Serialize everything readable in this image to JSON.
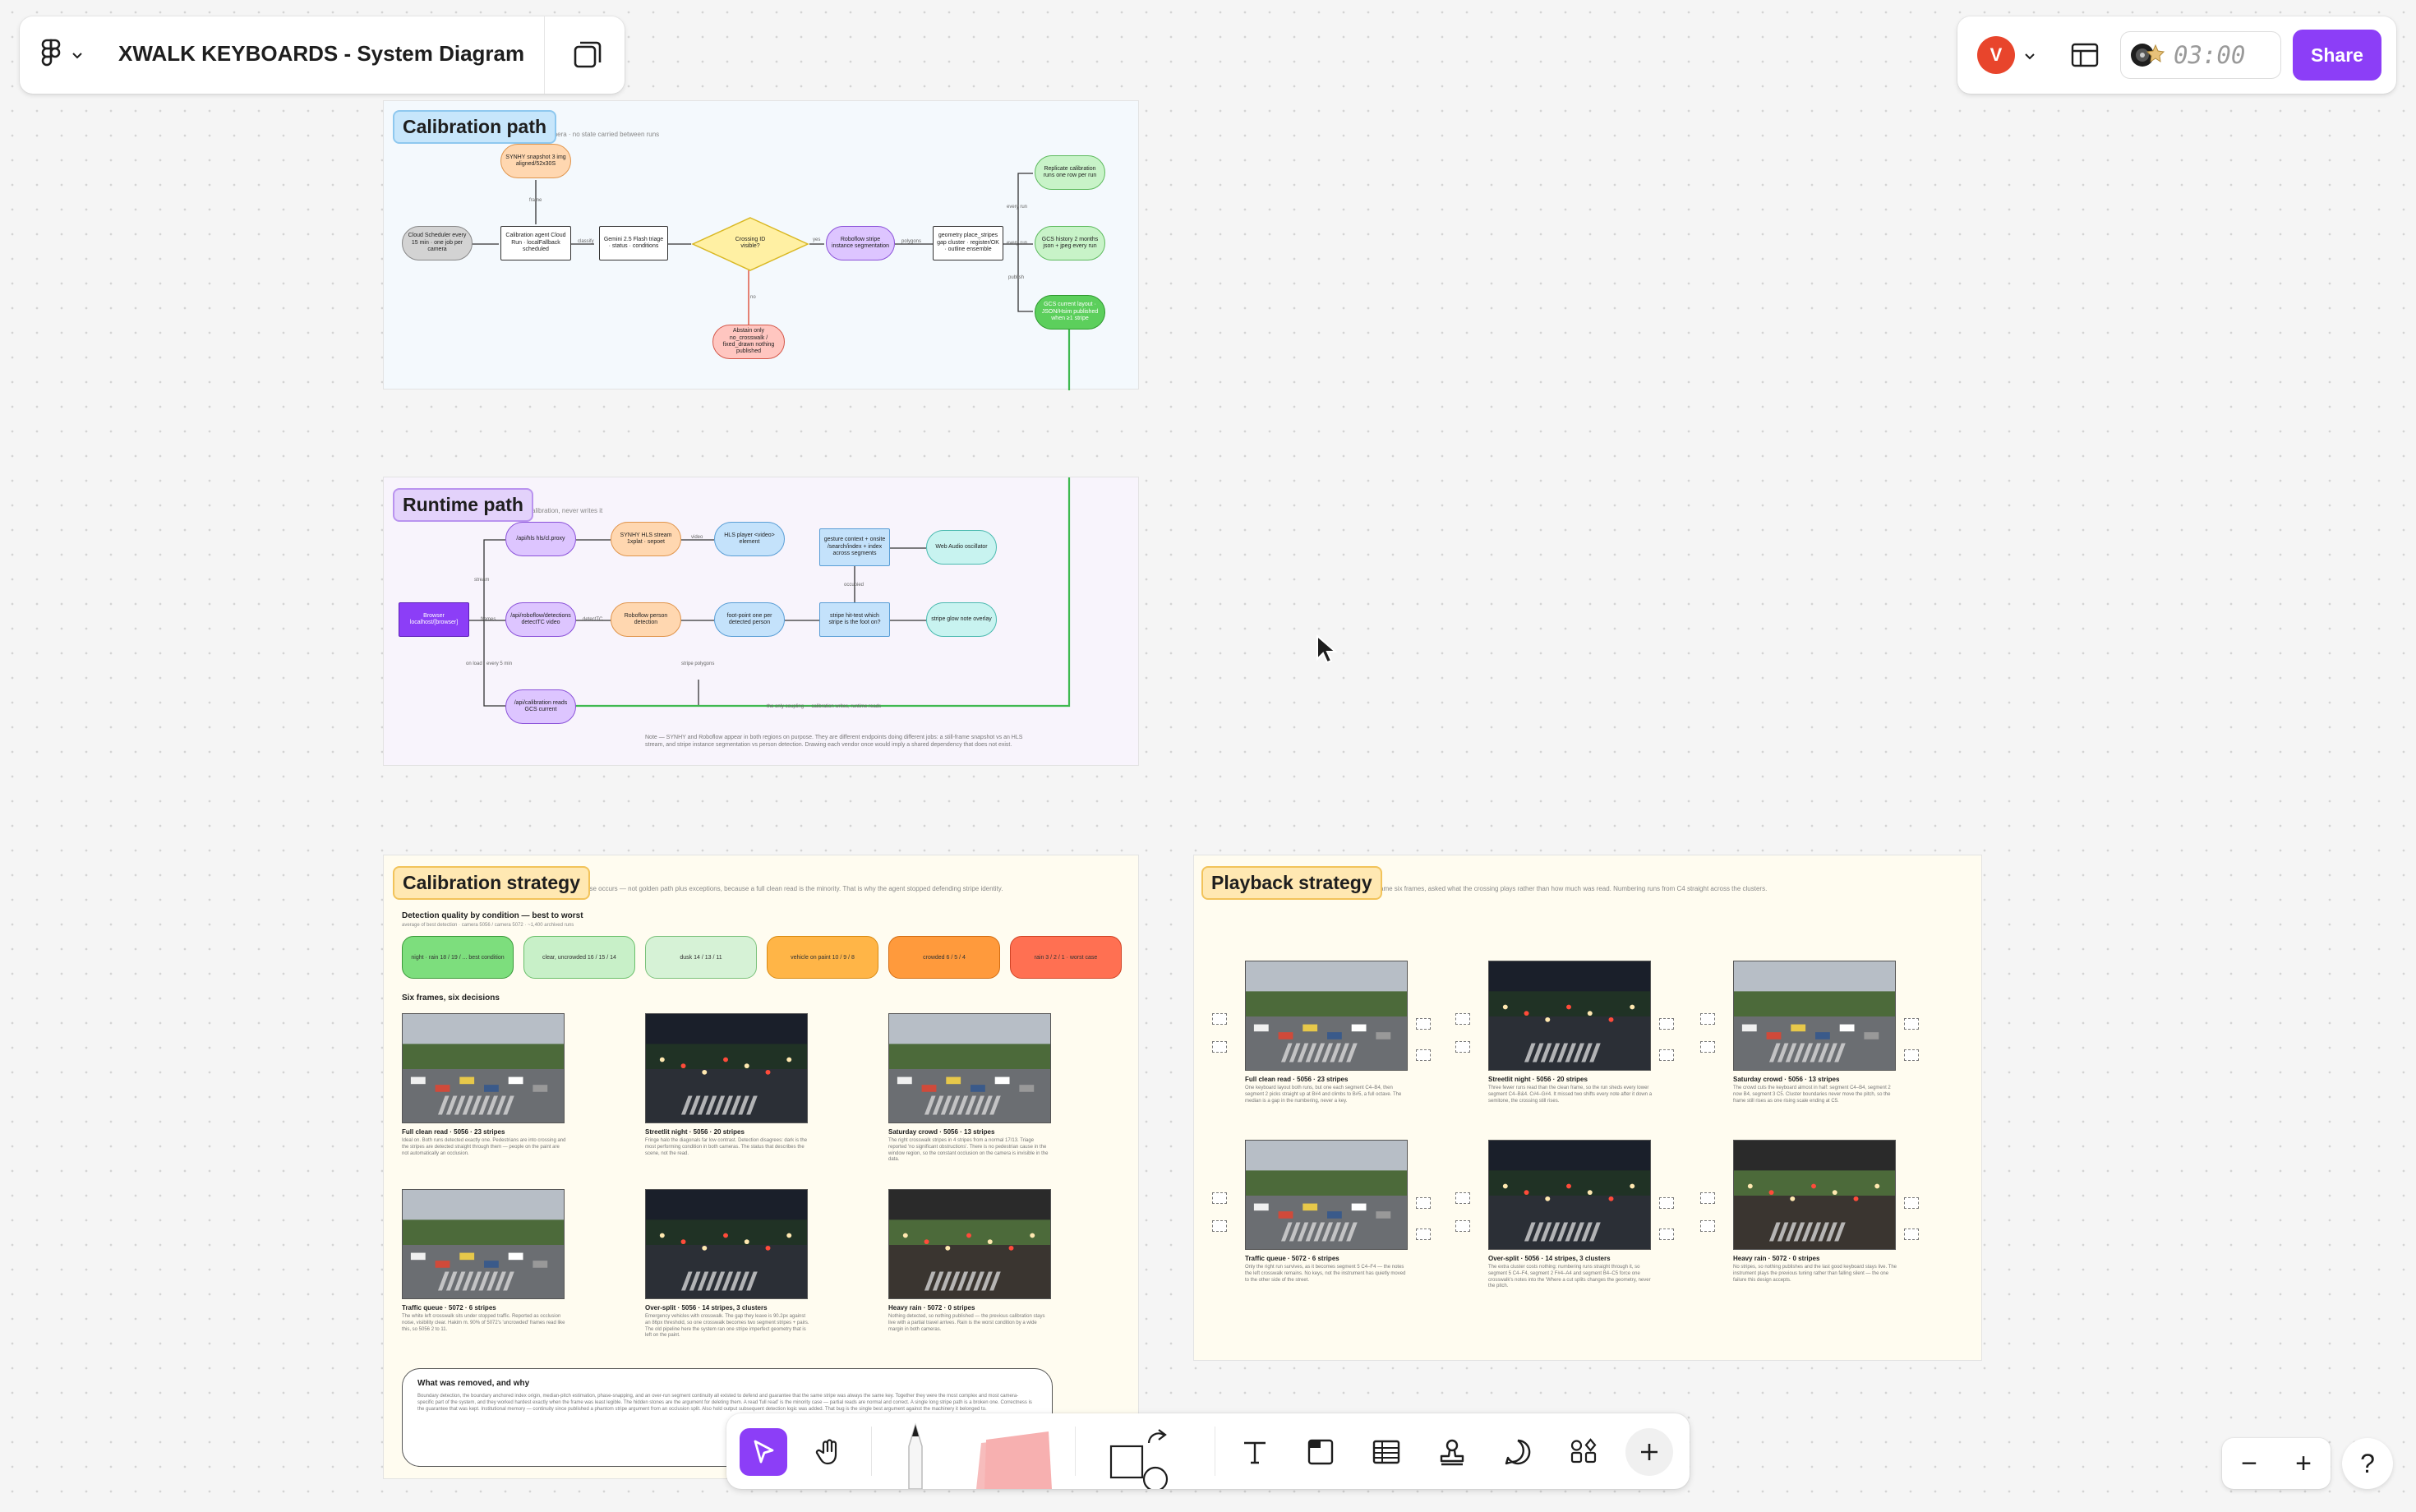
{
  "header": {
    "file_title": "XWALK KEYBOARDS - System Diagram"
  },
  "topright": {
    "avatar_initial": "V",
    "timer": "03:00",
    "share_label": "Share"
  },
  "calibration_path": {
    "label": "Calibration path",
    "subtitle": "camera · no state carried between runs",
    "nodes": {
      "snapshot": "SYNHY snapshot 3 img aligned/52x30S",
      "scheduler": "Cloud Scheduler every 15 min · one job per camera",
      "agent": "Calibration agent Cloud Run · localFallback scheduled",
      "gemini": "Gemini 2.5 Flash triage · status · conditions",
      "decision": "Crossing ID visible?",
      "roboflow": "Roboflow stripe instance segmentation",
      "geometry": "geometry place_stripes gap cluster · register/OK · outline ensemble",
      "registry": "Replicate calibration runs one row per run",
      "gcs": "GCS history 2 months json + jpeg every run",
      "current": "GCS current layout · JSON/Hsim published when ≥1 stripe",
      "abstain": "Abstain only no_crosswalk / fixed_drawn nothing published"
    },
    "edges": {
      "frame": "frame",
      "classify": "classify",
      "yes": "yes",
      "polygons": "polygons",
      "no": "no",
      "every_run": "every run",
      "every_run2": "every run",
      "publish": "publish"
    }
  },
  "runtime_path": {
    "label": "Runtime path",
    "subtitle": "calibration, never writes it",
    "nodes": {
      "browser": "Browser localhost/[browser]",
      "hls": "/api/hls hls/cl.proxy",
      "synhy": "SYNHY HLS stream 1xplat · sepoet",
      "hlsplayer": "HLS player <video> element",
      "gesture": "gesture context + onsite /search/index + index across segments",
      "webaudio": "Web Audio oscillator",
      "frames": "/api/roboflow/detections detectTC video",
      "roboflow": "Roboflow person detection",
      "footpoint": "foot-point one per detected person",
      "stripe": "stripe hit-test which stripe is the foot on?",
      "glow": "stripe glow note overlay",
      "apicalib": "/api/calibration reads GCS current"
    },
    "edges": {
      "stream": "stream",
      "video": "video",
      "frames": "frames",
      "detectTC": "detectTC",
      "occupied": "occupied",
      "on_load": "on load · every 5 min",
      "stripe_polygons": "stripe polygons",
      "link": "the only coupling — calibration writes, runtime reads"
    },
    "note": "Note — SYNHY and Roboflow appear in both regions on purpose. They are different endpoints doing different jobs: a still-frame snapshot vs an HLS stream, and stripe instance segmentation vs person detection. Drawing each vendor once would imply a shared dependency that does not exist."
  },
  "calibration_strategy": {
    "label": "Calibration strategy",
    "subtitle": "case occurs — not golden path plus exceptions, because a full clean read is the minority. That is why the agent stopped defending stripe identity.",
    "quality_title": "Detection quality by condition — best to worst",
    "quality_sub": "average of best detection · camera 5056 / camera 5072 · ~1,400 archived runs",
    "pills": [
      {
        "text": "night · rain 18 / 19 / ... best condition",
        "bg": "#7dde7d",
        "border": "#3a9a3a"
      },
      {
        "text": "clear, uncrowded 16 / 15 / 14",
        "bg": "#c8f0c8",
        "border": "#6abf6a"
      },
      {
        "text": "dusk 14 / 13 / 11",
        "bg": "#d6f2d6",
        "border": "#7cc27c"
      },
      {
        "text": "vehicle on paint 10 / 9 / 8",
        "bg": "#ffb547",
        "border": "#d98a12"
      },
      {
        "text": "crowded 6 / 5 / 4",
        "bg": "#ff9a3c",
        "border": "#d36d12"
      },
      {
        "text": "rain 3 / 2 / 1 · worst case",
        "bg": "#ff7052",
        "border": "#d04426"
      }
    ],
    "frames_title": "Six frames, six decisions",
    "frames": [
      {
        "title": "Full clean read · 5056 · 23 stripes",
        "desc": "Ideal on. Both runs detected exactly one. Pedestrians are into crossing and the stripes are detected straight through them — people on the paint are not automatically an occlusion."
      },
      {
        "title": "Streetlit night · 5056 · 20 stripes",
        "desc": "Fringe halo the diagonals far low contrast. Detection disagrees: dark is the most performing condition in both cameras. The status that describes the scene, not the read."
      },
      {
        "title": "Saturday crowd · 5056 · 13 stripes",
        "desc": "The right crosswalk stripes in 4 stripes from a normal 17/13. Triage reported 'no significant obstructions'. There is no pedestrian cause in the window region, so the constant occlusion on the camera is invisible in the data."
      },
      {
        "title": "Traffic queue · 5072 · 6 stripes",
        "desc": "The white left crosswalk sits under stopped traffic. Reported as occlusion noise, visibility clear. Hakim m. 90% of 5072's 'uncrowded' frames read like this, so 5056 2 to 11."
      },
      {
        "title": "Over-split · 5056 · 14 stripes, 3 clusters",
        "desc": "Emergency vehicles with crosswalk. The gap they leave is 90.2px against an 86px threshold, so one crosswalk becomes two segment stripes + pairs. The old pipeline here the system ran one stripe imperfect geometry that is left on the paint."
      },
      {
        "title": "Heavy rain · 5072 · 0 stripes",
        "desc": "Nothing detected, so nothing published — the previous calibration stays live with a partial travel arrives. Rain is the worst condition by a wide margin in both cameras."
      }
    ],
    "removed_title": "What was removed, and why",
    "removed_text": "Boundary detection, the boundary anchored index origin, median-pitch estimation, phase-snapping, and an over-run segment continuity all existed to defend and guarantee that the same stripe was always the same key. Together they were the most complex and most camera-specific part of the system, and they worked hardest exactly when the frame was least legible. The hidden stones are the argument for deleting them. A read 'full read' is the minority case — partial reads are normal and correct. A single long stripe path is a broken one. Correctness is the guarantee that was kept. Institutional memory — continuity since published a phantom stripe argument from an occlusion split. Also hold output subsequent detection logic was added. That bug is the single best argument against the machinery it belonged to."
  },
  "playback_strategy": {
    "label": "Playback strategy",
    "subtitle": "same six frames, asked what the crossing plays rather than how much was read. Numbering runs from C4 straight across the clusters.",
    "frames": [
      {
        "title": "Full clean read · 5056 · 23 stripes",
        "desc": "One keyboard layout both runs, but one each segment C4–B4, then segment 2 picks straight up at B#4 and climbs to B#5, a full octave. The median is a gap in the numbering, never a key."
      },
      {
        "title": "Streetlit night · 5056 · 20 stripes",
        "desc": "Three fewer runs read than the clean frame, so the run sheds every lower segment C4–B&4. C#4–G#4. It missed two shifts every note after it down a semitone, the crossing still rises."
      },
      {
        "title": "Saturday crowd · 5056 · 13 stripes",
        "desc": "The crowd cuts the keyboard almost in half: segment C4–B4, segment 2 now B4, segment 3 C5. Cluster boundaries never move the pitch, so the frame still rises as one rising scale ending at C5."
      },
      {
        "title": "Traffic queue · 5072 · 6 stripes",
        "desc": "Only the right run survives, as it becomes segment 5 C4–F4 — the notes the left crosswalk remains. No keys, not the instrument has quietly moved to the other side of the street."
      },
      {
        "title": "Over-split · 5056 · 14 stripes, 3 clusters",
        "desc": "The extra cluster costs nothing: numbering runs straight through it, so segment 5 C4–F4, segment 2 F#4–A4 and segment B4–C5 force one crosswalk's notes into the 'Where a cut splits changes the geometry, never the pitch."
      },
      {
        "title": "Heavy rain · 5072 · 0 stripes",
        "desc": "No stripes, so nothing publishes and the last good keyboard stays live. The instrument plays the previous tuning rather than falling silent — the one failure this design accepts."
      }
    ]
  },
  "toolbar": {
    "tools": [
      "Move",
      "Hand",
      "Pencil",
      "Sticky note",
      "Shape",
      "Connector",
      "Text",
      "Section",
      "Table",
      "Stamp",
      "Comment",
      "Actions",
      "More"
    ]
  },
  "zoom": {
    "minus": "−",
    "plus": "+",
    "help": "?"
  }
}
